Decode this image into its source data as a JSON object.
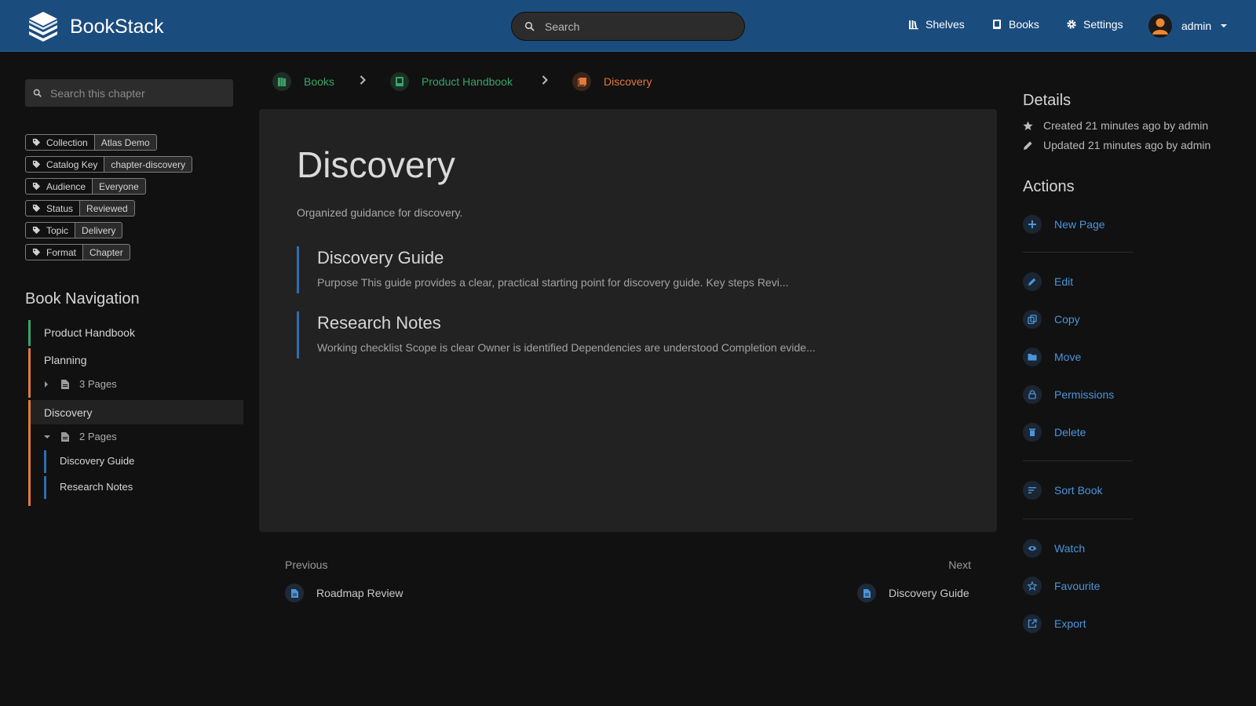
{
  "app": {
    "name": "BookStack"
  },
  "header": {
    "search_placeholder": "Search",
    "nav": [
      {
        "label": "Shelves",
        "icon": "shelves-icon"
      },
      {
        "label": "Books",
        "icon": "books-icon"
      },
      {
        "label": "Settings",
        "icon": "settings-icon"
      }
    ],
    "user": {
      "name": "admin"
    }
  },
  "sidebar": {
    "search_placeholder": "Search this chapter",
    "tags": [
      {
        "name": "Collection",
        "value": "Atlas Demo"
      },
      {
        "name": "Catalog Key",
        "value": "chapter-discovery"
      },
      {
        "name": "Audience",
        "value": "Everyone"
      },
      {
        "name": "Status",
        "value": "Reviewed"
      },
      {
        "name": "Topic",
        "value": "Delivery"
      },
      {
        "name": "Format",
        "value": "Chapter"
      }
    ],
    "book_nav_title": "Book Navigation",
    "book": "Product Handbook",
    "chapters": [
      {
        "label": "Planning",
        "pages_label": "3 Pages"
      },
      {
        "label": "Discovery",
        "pages_label": "2 Pages",
        "pages": [
          "Discovery Guide",
          "Research Notes"
        ]
      }
    ]
  },
  "breadcrumbs": [
    {
      "label": "Books",
      "color": "#3aa56a"
    },
    {
      "label": "Product Handbook",
      "color": "#3aa56a"
    },
    {
      "label": "Discovery",
      "color": "#e07a3a"
    }
  ],
  "chapter": {
    "title": "Discovery",
    "description": "Organized guidance for discovery.",
    "pages": [
      {
        "title": "Discovery Guide",
        "excerpt": "Purpose This guide provides a clear, practical starting point for discovery guide. Key steps Revi..."
      },
      {
        "title": "Research Notes",
        "excerpt": "Working checklist Scope is clear Owner is identified Dependencies are understood Completion evide..."
      }
    ]
  },
  "pager": {
    "previous_label": "Previous",
    "previous_title": "Roadmap Review",
    "next_label": "Next",
    "next_title": "Discovery Guide"
  },
  "details": {
    "heading": "Details",
    "created": "Created 21 minutes ago by admin",
    "updated": "Updated 21 minutes ago by admin"
  },
  "actions": {
    "heading": "Actions",
    "new_page": "New Page",
    "edit": "Edit",
    "copy": "Copy",
    "move": "Move",
    "permissions": "Permissions",
    "delete": "Delete",
    "sort_book": "Sort Book",
    "watch": "Watch",
    "favourite": "Favourite",
    "export": "Export"
  },
  "colors": {
    "header": "#1b4c7e",
    "book": "#3aa56a",
    "chapter": "#e07a3a",
    "page": "#2f6db3",
    "link": "#4b95dd"
  }
}
